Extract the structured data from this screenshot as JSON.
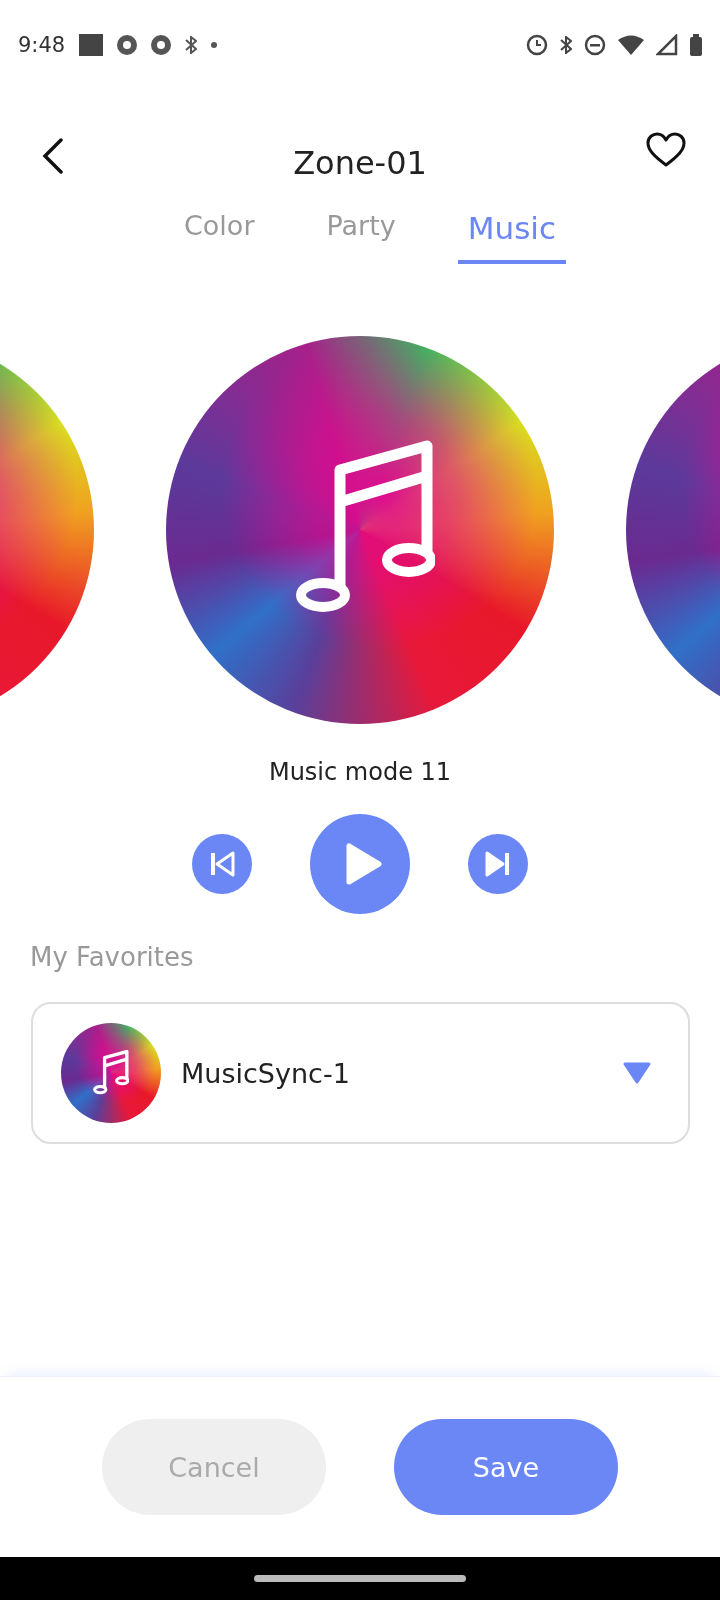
{
  "status_bar": {
    "time": "9:48"
  },
  "header": {
    "title": "Zone-01"
  },
  "tabs": [
    {
      "label": "Color",
      "selected": false
    },
    {
      "label": "Party",
      "selected": false
    },
    {
      "label": "Music",
      "selected": true
    }
  ],
  "player": {
    "mode_name": "Music mode 11"
  },
  "favorites": {
    "label": "My Favorites",
    "value": "MusicSync-1"
  },
  "buttons": [
    {
      "label": "Cancel",
      "kind": "secondary"
    },
    {
      "label": "Save",
      "kind": "primary"
    }
  ]
}
